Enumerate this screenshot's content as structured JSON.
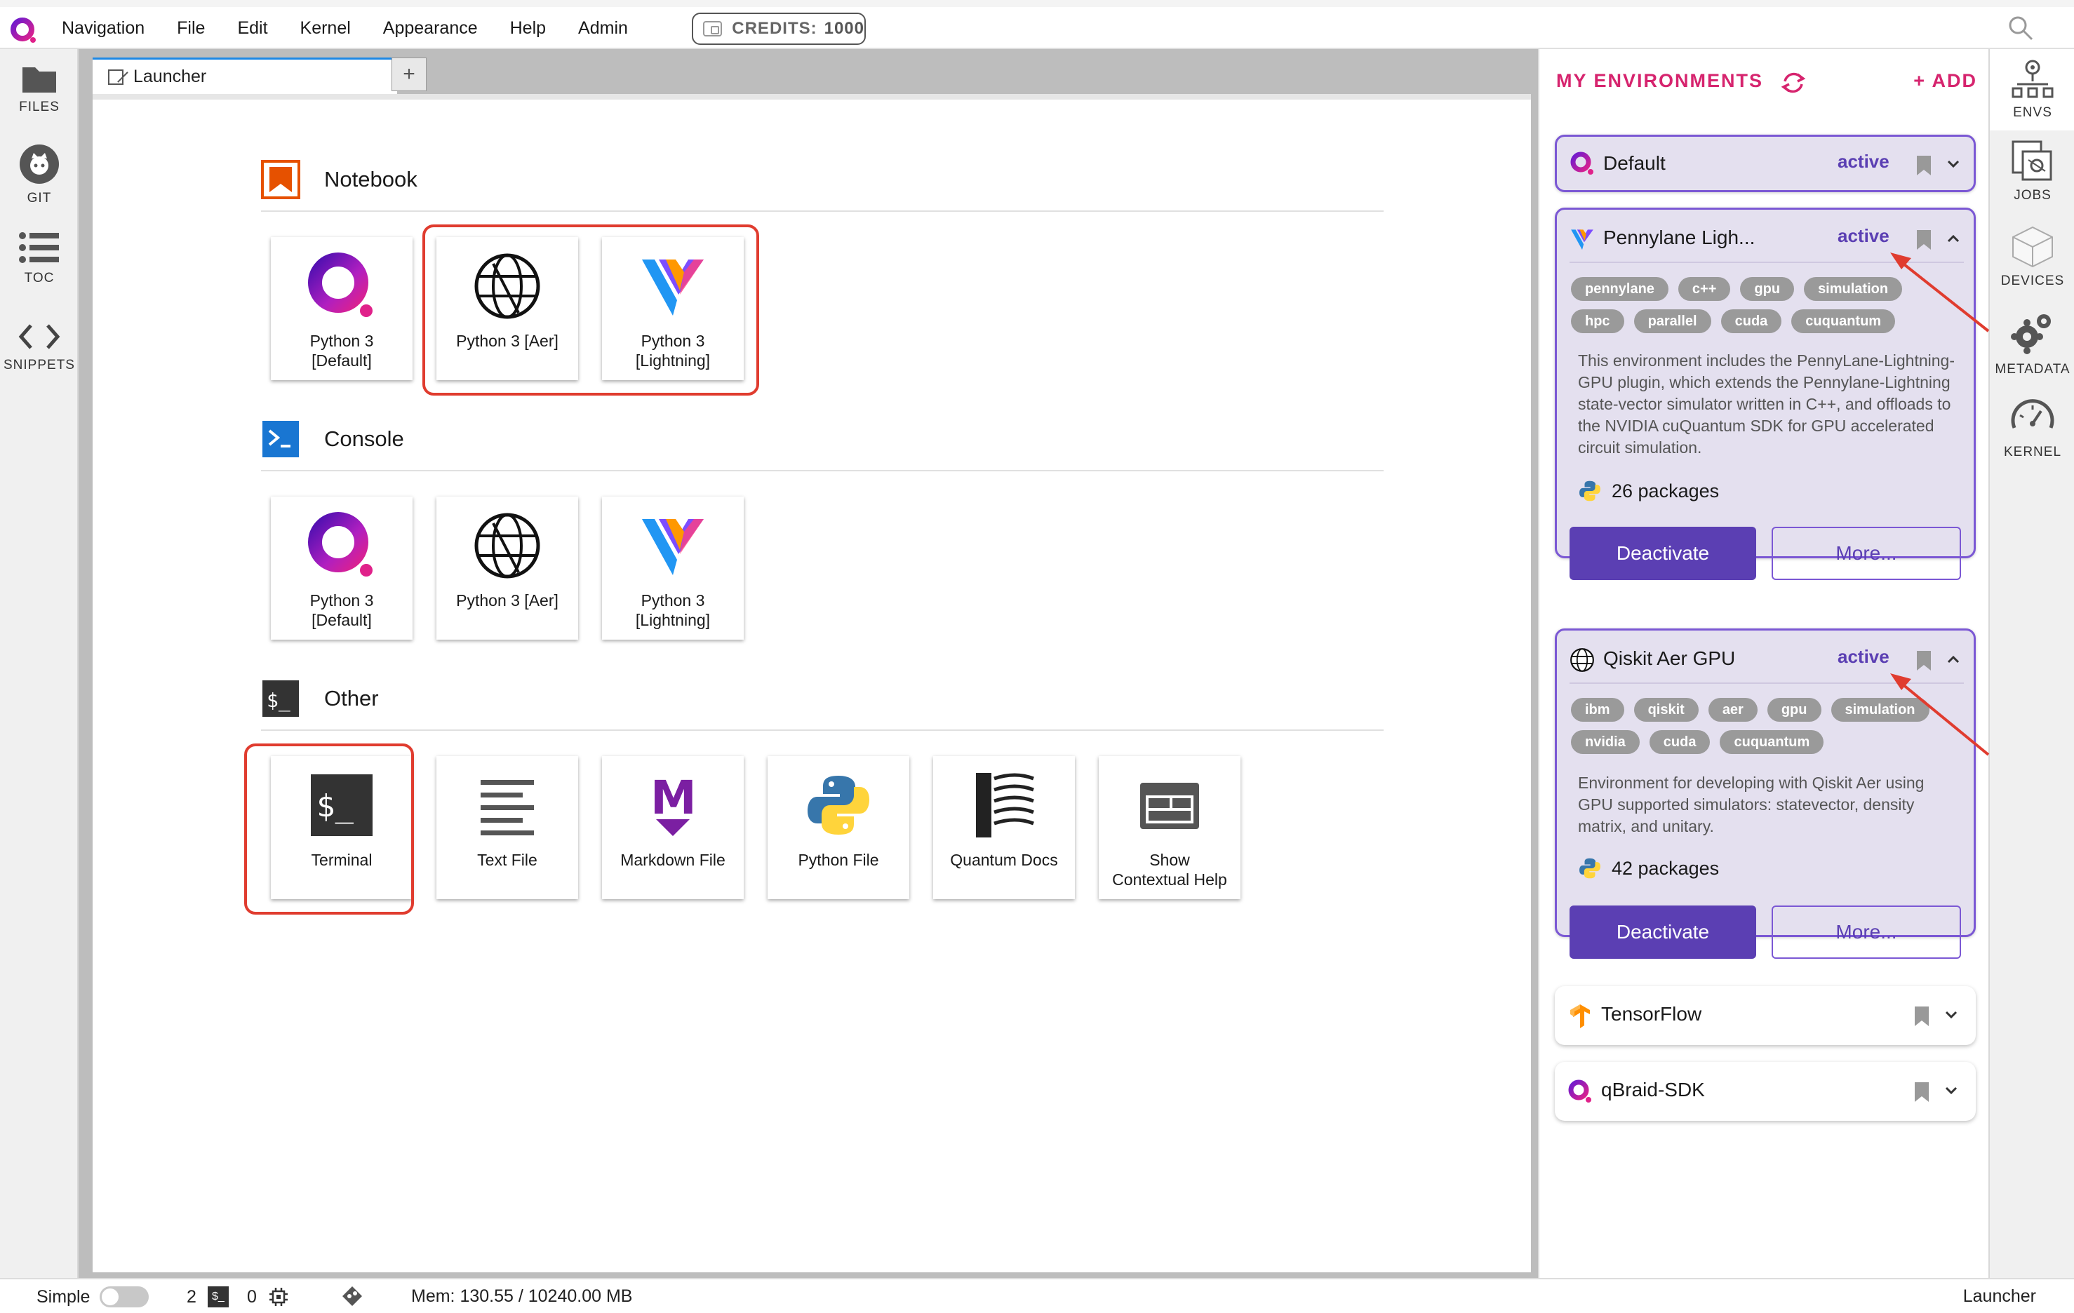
{
  "menubar": {
    "items": [
      "Navigation",
      "File",
      "Edit",
      "Kernel",
      "Appearance",
      "Help",
      "Admin"
    ],
    "credits_label": "CREDITS:",
    "credits_value": "1000"
  },
  "left_sidebar": {
    "items": [
      {
        "label": "FILES",
        "icon": "folder-icon"
      },
      {
        "label": "GIT",
        "icon": "git-icon"
      },
      {
        "label": "TOC",
        "icon": "toc-icon"
      },
      {
        "label": "SNIPPETS",
        "icon": "code-icon"
      }
    ]
  },
  "tabs": {
    "launcher": "Launcher",
    "add": "+"
  },
  "launcher": {
    "notebook": {
      "title": "Notebook",
      "cards": [
        "Python 3\n[Default]",
        "Python 3 [Aer]",
        "Python 3\n[Lightning]"
      ]
    },
    "console": {
      "title": "Console",
      "cards": [
        "Python 3\n[Default]",
        "Python 3 [Aer]",
        "Python 3\n[Lightning]"
      ]
    },
    "other": {
      "title": "Other",
      "cards": [
        "Terminal",
        "Text File",
        "Markdown File",
        "Python File",
        "Quantum Docs",
        "Show\nContextual Help"
      ]
    }
  },
  "env_panel": {
    "title": "MY ENVIRONMENTS",
    "add": "+ ADD",
    "envs": [
      {
        "name": "Default",
        "status": "active"
      },
      {
        "name": "Pennylane Ligh...",
        "status": "active",
        "tags": [
          "pennylane",
          "c++",
          "gpu",
          "simulation",
          "hpc",
          "parallel",
          "cuda",
          "cuquantum"
        ],
        "description": "This environment includes the PennyLane-Lightning-GPU plugin, which extends the Pennylane-Lightning state-vector simulator written in C++, and offloads to the NVIDIA cuQuantum SDK for GPU accelerated circuit simulation.",
        "packages": "26 packages",
        "deactivate": "Deactivate",
        "more": "More..."
      },
      {
        "name": "Qiskit Aer GPU",
        "status": "active",
        "tags": [
          "ibm",
          "qiskit",
          "aer",
          "gpu",
          "simulation",
          "nvidia",
          "cuda",
          "cuquantum"
        ],
        "description": "Environment for developing with Qiskit Aer using GPU supported simulators: statevector, density matrix, and unitary.",
        "packages": "42 packages",
        "deactivate": "Deactivate",
        "more": "More..."
      },
      {
        "name": "TensorFlow"
      },
      {
        "name": "qBraid-SDK"
      }
    ]
  },
  "right_sidebar": {
    "items": [
      {
        "label": "ENVS",
        "icon": "envs-icon"
      },
      {
        "label": "JOBS",
        "icon": "jobs-icon"
      },
      {
        "label": "DEVICES",
        "icon": "devices-icon"
      },
      {
        "label": "METADATA",
        "icon": "gears-icon"
      },
      {
        "label": "KERNEL",
        "icon": "gauge-icon"
      }
    ]
  },
  "statusbar": {
    "mode": "Simple",
    "terminals": "2",
    "kernels": "0",
    "memory": "Mem: 130.55 / 10240.00 MB",
    "right": "Launcher"
  },
  "colors": {
    "accent": "#d6246e",
    "env_purple": "#5b3fb3",
    "highlight_red": "#e03c2f",
    "tab_blue": "#1e88e5"
  }
}
